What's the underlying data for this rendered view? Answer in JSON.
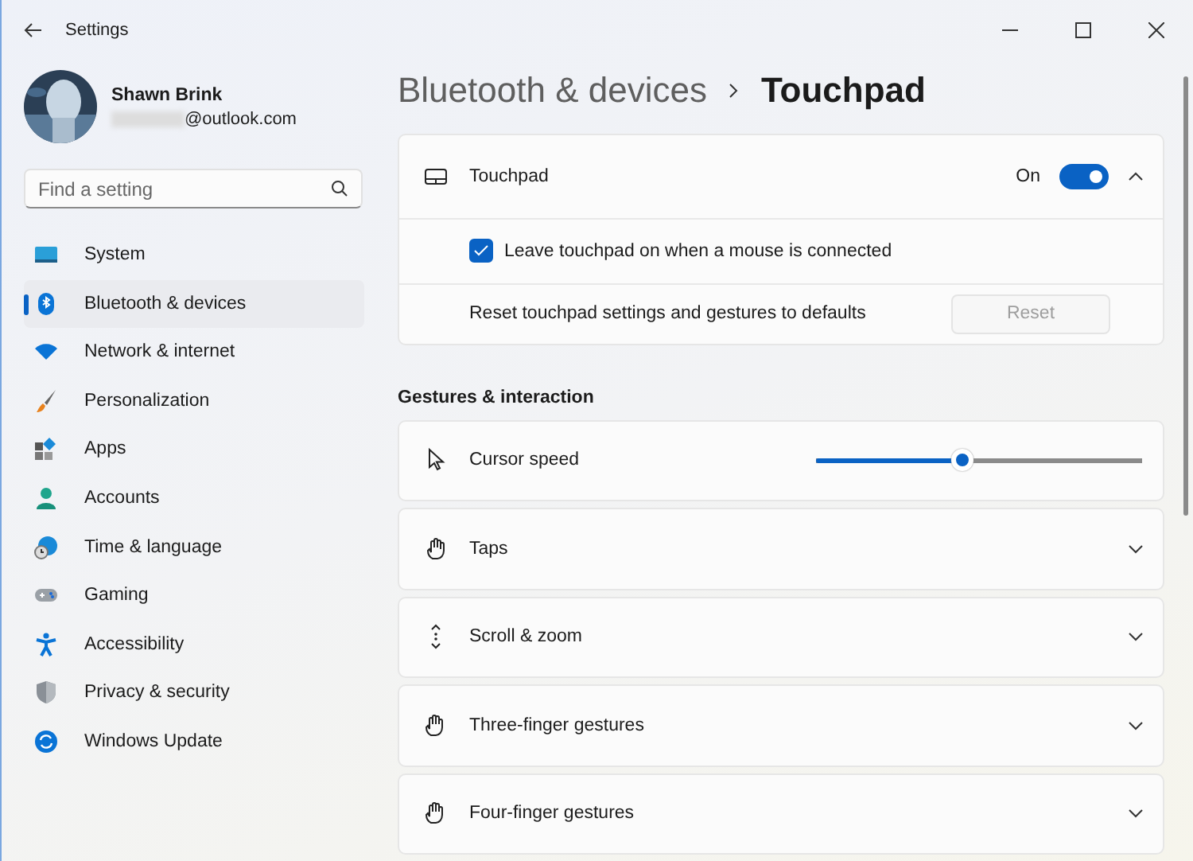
{
  "window": {
    "title": "Settings"
  },
  "account": {
    "name": "Shawn Brink",
    "email": "@outlook.com"
  },
  "search": {
    "placeholder": "Find a setting"
  },
  "sidebar": {
    "items": [
      {
        "label": "System",
        "selected": false
      },
      {
        "label": "Bluetooth & devices",
        "selected": true
      },
      {
        "label": "Network & internet",
        "selected": false
      },
      {
        "label": "Personalization",
        "selected": false
      },
      {
        "label": "Apps",
        "selected": false
      },
      {
        "label": "Accounts",
        "selected": false
      },
      {
        "label": "Time & language",
        "selected": false
      },
      {
        "label": "Gaming",
        "selected": false
      },
      {
        "label": "Accessibility",
        "selected": false
      },
      {
        "label": "Privacy & security",
        "selected": false
      },
      {
        "label": "Windows Update",
        "selected": false
      }
    ]
  },
  "breadcrumb": {
    "parent": "Bluetooth & devices",
    "current": "Touchpad"
  },
  "touchpad": {
    "label": "Touchpad",
    "state_text": "On",
    "on": true,
    "expanded": true,
    "option": {
      "label": "Leave touchpad on when a mouse is connected",
      "checked": true
    },
    "reset": {
      "label": "Reset touchpad settings and gestures to defaults",
      "button": "Reset",
      "disabled": true
    }
  },
  "section_title": "Gestures & interaction",
  "settings": [
    {
      "kind": "slider",
      "label": "Cursor speed",
      "level": 0.45
    },
    {
      "kind": "expander",
      "label": "Taps",
      "expanded": false
    },
    {
      "kind": "expander",
      "label": "Scroll & zoom",
      "expanded": false
    },
    {
      "kind": "expander",
      "label": "Three-finger gestures",
      "expanded": false
    },
    {
      "kind": "expander",
      "label": "Four-finger gestures",
      "expanded": false
    }
  ]
}
